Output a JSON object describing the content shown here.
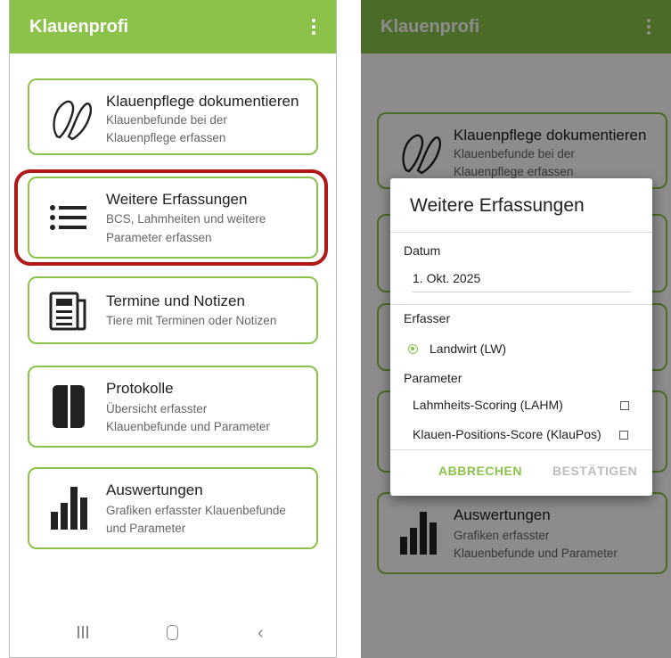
{
  "app": {
    "title": "Klauenprofi"
  },
  "menu": [
    {
      "title": "Klauenpflege dokumentieren",
      "subtitle": [
        "Klauenbefunde bei der",
        "Klauenpflege erfassen"
      ]
    },
    {
      "title": "Weitere Erfassungen",
      "subtitle": [
        "BCS, Lahmheiten und weitere",
        "Parameter erfassen"
      ]
    },
    {
      "title": "Termine und Notizen",
      "subtitle": [
        "Tiere mit Terminen oder Notizen"
      ]
    },
    {
      "title": "Protokolle",
      "subtitle": [
        "Übersicht erfasster",
        "Klauenbefunde und Parameter"
      ]
    },
    {
      "title": "Auswertungen",
      "subtitle": [
        "Grafiken erfasster Klauenbefunde",
        "und Parameter"
      ]
    }
  ],
  "right_menu": [
    {
      "title": "Klauenpflege dokumentieren",
      "subtitle": [
        "Klauenbefunde bei der",
        "Klauenpflege erfassen"
      ]
    },
    {
      "title": "Auswertungen",
      "subtitle": [
        "Grafiken erfasster",
        "Klauenbefunde und Parameter"
      ]
    }
  ],
  "dialog": {
    "title": "Weitere Erfassungen",
    "date_label": "Datum",
    "date_value": "1. Okt. 2025",
    "erfasser_label": "Erfasser",
    "erfasser_option": "Landwirt (LW)",
    "parameter_label": "Parameter",
    "parameters": [
      "Lahmheits-Scoring (LAHM)",
      "Klauen-Positions-Score (KlauPos)"
    ],
    "cancel": "ABBRECHEN",
    "confirm": "BESTÄTIGEN"
  },
  "colors": {
    "accent": "#8bc34a",
    "highlight": "#b01818"
  },
  "icons": [
    "claw-icon",
    "list-icon",
    "newspaper-icon",
    "book-icon",
    "bar-chart-icon",
    "overflow-menu-icon"
  ]
}
